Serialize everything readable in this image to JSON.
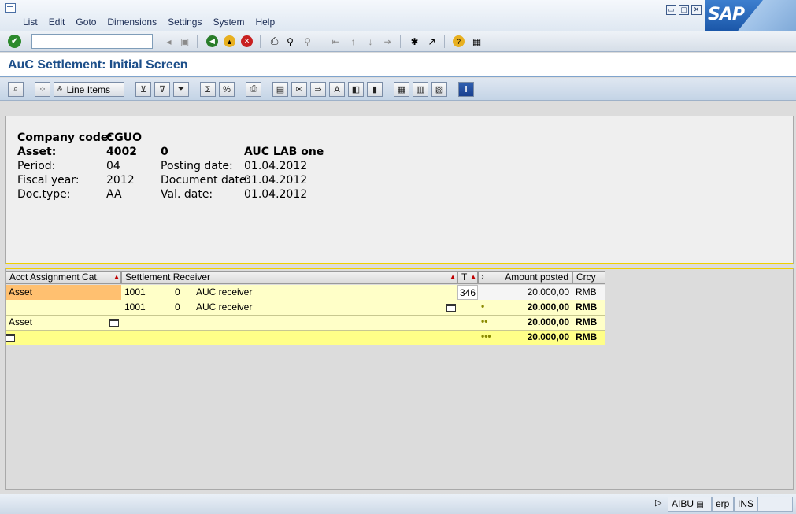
{
  "menubar": {
    "items": [
      "List",
      "Edit",
      "Goto",
      "Dimensions",
      "Settings",
      "System",
      "Help"
    ],
    "window_buttons": [
      "▭",
      "▢",
      "✕"
    ],
    "logo_text": "SAP"
  },
  "stdbar": {
    "command_value": ""
  },
  "title": "AuC Settlement: Initial Screen",
  "appbar": {
    "line_items_label": "Line Items"
  },
  "header": {
    "company_code_label": "Company code:",
    "company_code_value": "CGUO",
    "asset_label": "Asset:",
    "asset_value": "4002",
    "asset_subnumber": "0",
    "asset_description": "AUC LAB one",
    "period_label": "Period:",
    "period_value": "04",
    "posting_date_label": "Posting date:",
    "posting_date_value": "01.04.2012",
    "fiscal_year_label": "Fiscal year:",
    "fiscal_year_value": "2012",
    "document_date_label": "Document date:",
    "document_date_value": "01.04.2012",
    "doc_type_label": "Doc.type:",
    "doc_type_value": "AA",
    "val_date_label": "Val. date:",
    "val_date_value": "01.04.2012"
  },
  "grid": {
    "columns": [
      "Acct Assignment Cat.",
      "Settlement Receiver",
      "T",
      "Amount posted",
      "Crcy"
    ],
    "rows": [
      {
        "cat": "Asset",
        "receiver_no": "1001",
        "receiver_sub": "0",
        "receiver_text": "AUC receiver",
        "t": "346",
        "amount": "20.000,00",
        "crcy": "RMB"
      },
      {
        "cat": "",
        "receiver_no": "1001",
        "receiver_sub": "0",
        "receiver_text": "AUC receiver",
        "t": "",
        "amount": "20.000,00",
        "crcy": "RMB"
      }
    ],
    "subtotal_asset_label": "Asset",
    "subtotal_amount": "20.000,00",
    "subtotal_crcy": "RMB",
    "total_amount": "20.000,00",
    "total_crcy": "RMB",
    "level1_dots": "•",
    "level2_dots": "••",
    "level3_dots": "•••"
  },
  "statusbar": {
    "transaction": "AIBU",
    "system": "erp",
    "mode": "INS"
  }
}
